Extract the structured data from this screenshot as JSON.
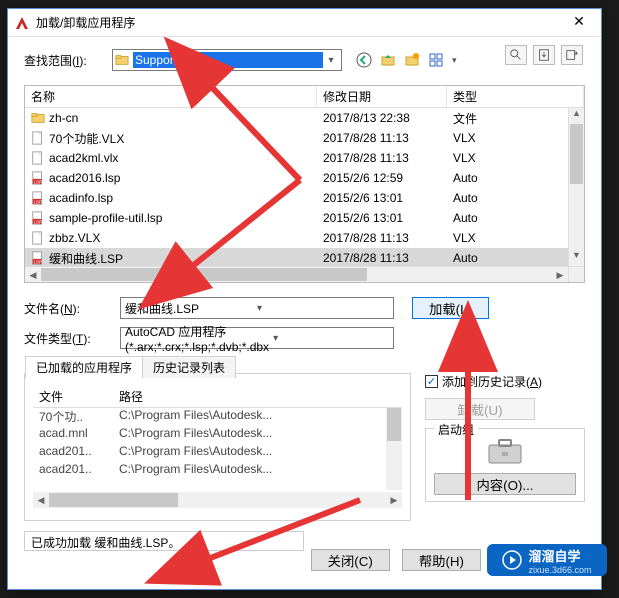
{
  "window": {
    "title": "加载/卸载应用程序"
  },
  "lookin": {
    "label_pre": "查找范围(",
    "label_key": "I",
    "label_post": "):",
    "value": "Support"
  },
  "columns": {
    "name": "名称",
    "date": "修改日期",
    "type": "类型"
  },
  "files": [
    {
      "icon": "folder",
      "name": "zh-cn",
      "date": "2017/8/13 22:38",
      "type": "文件"
    },
    {
      "icon": "vlx",
      "name": "70个功能.VLX",
      "date": "2017/8/28 11:13",
      "type": "VLX"
    },
    {
      "icon": "vlx",
      "name": "acad2kml.vlx",
      "date": "2017/8/28 11:13",
      "type": "VLX"
    },
    {
      "icon": "lsp",
      "name": "acad2016.lsp",
      "date": "2015/2/6 12:59",
      "type": "Auto"
    },
    {
      "icon": "lsp",
      "name": "acadinfo.lsp",
      "date": "2015/2/6 13:01",
      "type": "Auto"
    },
    {
      "icon": "lsp",
      "name": "sample-profile-util.lsp",
      "date": "2015/2/6 13:01",
      "type": "Auto"
    },
    {
      "icon": "vlx",
      "name": "zbbz.VLX",
      "date": "2017/8/28 11:13",
      "type": "VLX"
    },
    {
      "icon": "lsp",
      "name": "缓和曲线.LSP",
      "date": "2017/8/28 11:13",
      "type": "Auto",
      "selected": true
    }
  ],
  "filename": {
    "label_pre": "文件名(",
    "label_key": "N",
    "label_post": "):",
    "value": "缓和曲线.LSP"
  },
  "filetype": {
    "label_pre": "文件类型(",
    "label_key": "T",
    "label_post": "):",
    "value": "AutoCAD 应用程序(*.arx;*.crx;*.lsp;*.dvb;*.dbx"
  },
  "buttons": {
    "load": "加载(L)",
    "unload": "卸载(U)",
    "contents": "内容(O)...",
    "close": "关闭(C)",
    "help": "帮助(H)"
  },
  "tabs": {
    "loaded": "已加载的应用程序",
    "history": "历史记录列表"
  },
  "loaded_header": {
    "file": "文件",
    "path": "路径"
  },
  "loaded_rows": [
    {
      "file": "70个功..",
      "path": "C:\\Program Files\\Autodesk..."
    },
    {
      "file": "acad.mnl",
      "path": "C:\\Program Files\\Autodesk..."
    },
    {
      "file": "acad201..",
      "path": "C:\\Program Files\\Autodesk..."
    },
    {
      "file": "acad201..",
      "path": "C:\\Program Files\\Autodesk..."
    }
  ],
  "addhistory": {
    "label_pre": "添加到历史记录(",
    "label_key": "A",
    "label_post": ")",
    "checked": true
  },
  "startup_group": "启动组",
  "status": "已成功加载 缓和曲线.LSP。",
  "watermark": {
    "brand": "溜溜自学",
    "sub": "zixue.3d66.com"
  },
  "nav_arrow_text": "▾"
}
